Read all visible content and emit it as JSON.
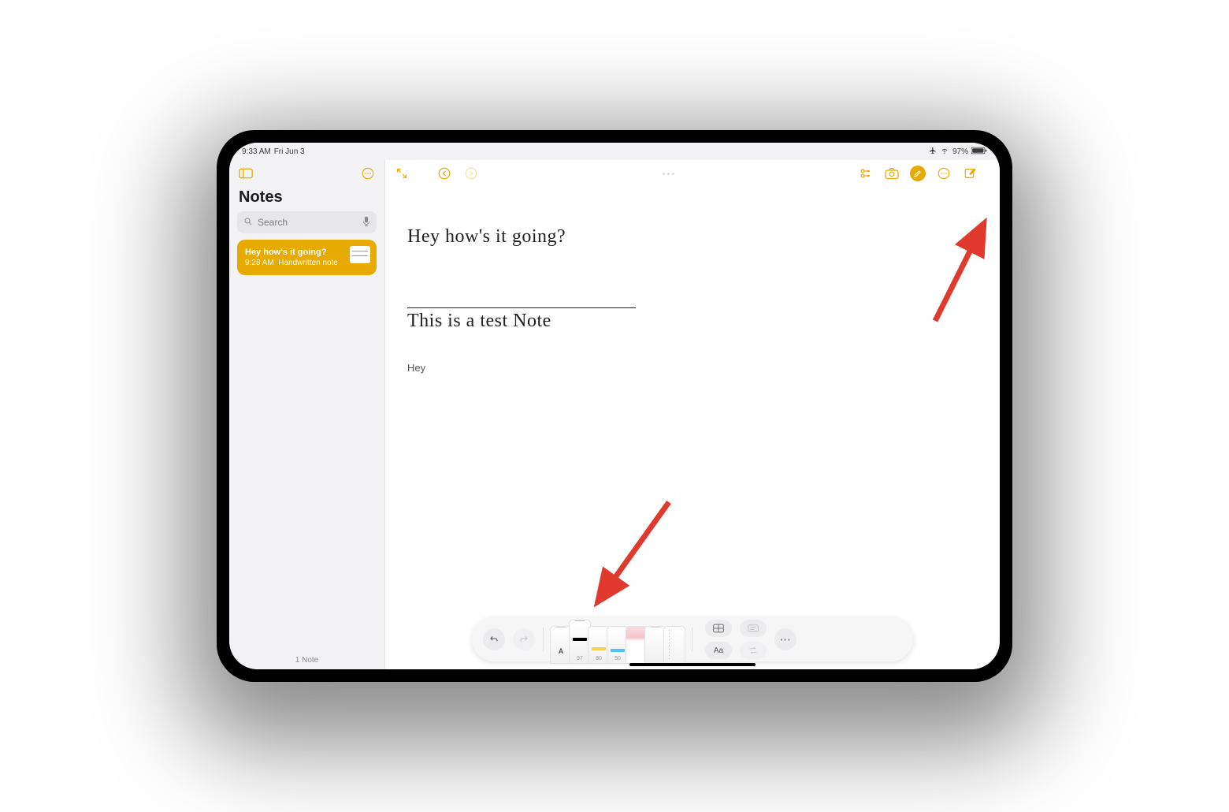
{
  "status": {
    "time": "9:33 AM",
    "date": "Fri Jun 3",
    "battery": "97%"
  },
  "sidebar": {
    "title": "Notes",
    "search_placeholder": "Search",
    "note": {
      "title": "Hey how's it going?",
      "time": "9:28 AM",
      "subtitle": "Handwritten note"
    },
    "footer": "1 Note"
  },
  "editor": {
    "handwriting_line1": "Hey how's it going?",
    "handwriting_line2": "This is a test Note",
    "typed": "Hey"
  },
  "palette": {
    "pen_black_label": "97",
    "pen_yellow_label": "80",
    "pen_cyan_label": "50",
    "aa": "Aa",
    "scribble_label": "A"
  }
}
